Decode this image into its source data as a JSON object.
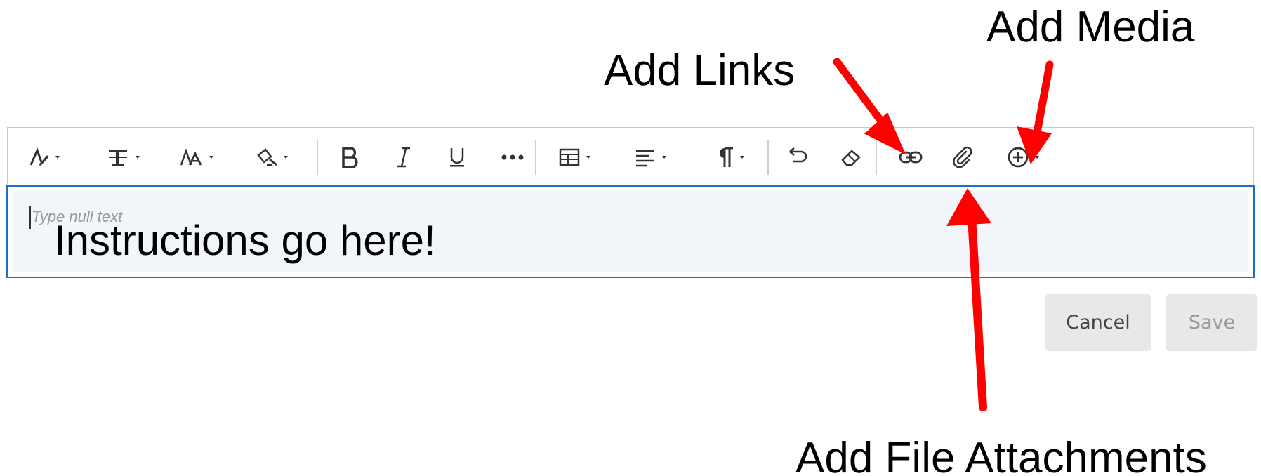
{
  "annotations": {
    "add_links": "Add Links",
    "add_media": "Add Media",
    "add_file_attachments": "Add File Attachments"
  },
  "toolbar": {
    "icons": [
      "text-style-icon",
      "font-family-icon",
      "font-size-icon",
      "text-color-icon",
      "bold-icon",
      "italic-icon",
      "underline-icon",
      "more-icon",
      "table-icon",
      "align-icon",
      "paragraph-icon",
      "undo-icon",
      "eraser-icon",
      "link-icon",
      "paperclip-icon",
      "add-media-icon"
    ]
  },
  "editor": {
    "placeholder": "Type null text",
    "content": "Instructions go here!"
  },
  "actions": {
    "cancel_label": "Cancel",
    "save_label": "Save"
  },
  "colors": {
    "arrow": "#ff0000",
    "editor_border": "#1e6fc9",
    "toolbar_border": "#c8c8c8",
    "button_bg": "#e8e8e8"
  }
}
